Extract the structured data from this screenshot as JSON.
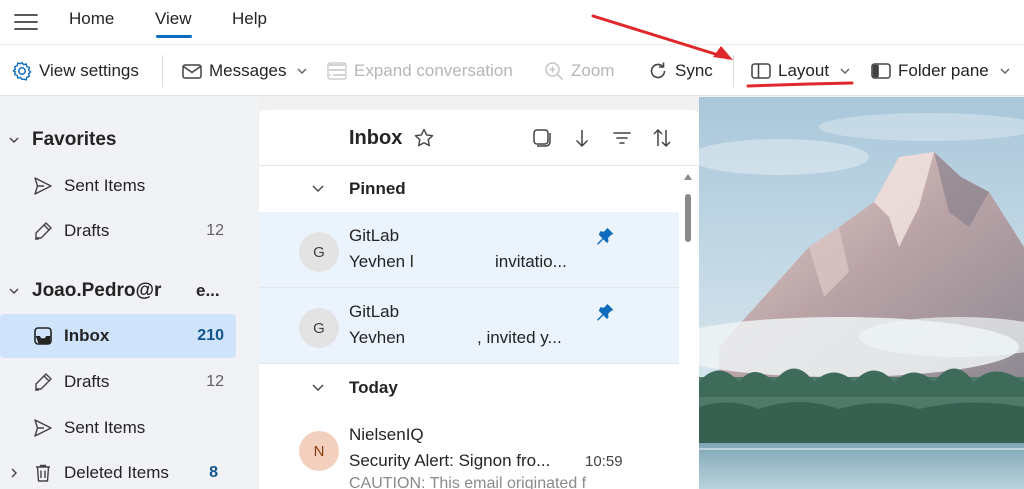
{
  "topnav": {
    "tabs": [
      {
        "label": "Home"
      },
      {
        "label": "View"
      },
      {
        "label": "Help"
      }
    ],
    "active_tab": "View",
    "accent_color": "#0f6cbd"
  },
  "ribbon": {
    "view_settings": "View settings",
    "messages": "Messages",
    "expand_conversation": "Expand conversation",
    "zoom": "Zoom",
    "sync": "Sync",
    "layout": "Layout",
    "folder_pane": "Folder pane"
  },
  "sidebar": {
    "favorites": {
      "heading": "Favorites",
      "items": [
        {
          "label": "Sent Items",
          "count": "",
          "icon": "send-icon"
        },
        {
          "label": "Drafts",
          "count": "12",
          "icon": "pencil-icon"
        }
      ]
    },
    "account": {
      "heading": "Joao.Pedro@r",
      "heading_suffix": "e...",
      "items": [
        {
          "label": "Inbox",
          "count": "210",
          "icon": "inbox-icon",
          "selected": true
        },
        {
          "label": "Drafts",
          "count": "12",
          "icon": "pencil-icon"
        },
        {
          "label": "Sent Items",
          "count": "",
          "icon": "send-icon"
        },
        {
          "label": "Deleted Items",
          "count": "8",
          "icon": "trash-icon"
        }
      ]
    },
    "selected_color": "#cfe4fa"
  },
  "message_list": {
    "title": "Inbox",
    "groups": [
      {
        "label": "Pinned",
        "messages": [
          {
            "initial": "G",
            "sender": "GitLab",
            "subject_start": "Yevhen l",
            "subject_end": "invitatio...",
            "pinned": true
          },
          {
            "initial": "G",
            "sender": "GitLab",
            "subject_start": "Yevhen",
            "subject_end": ", invited y...",
            "pinned": true
          }
        ]
      },
      {
        "label": "Today",
        "messages": [
          {
            "initial": "N",
            "sender": "NielsenIQ",
            "subject_start": "Security Alert: Signon fro...",
            "subject_end": "",
            "time": "10:59",
            "preview": "CAUTION: This email originated f",
            "avatar_color": "#f3d0be"
          }
        ]
      }
    ]
  },
  "annotation_color": "#e0282c"
}
